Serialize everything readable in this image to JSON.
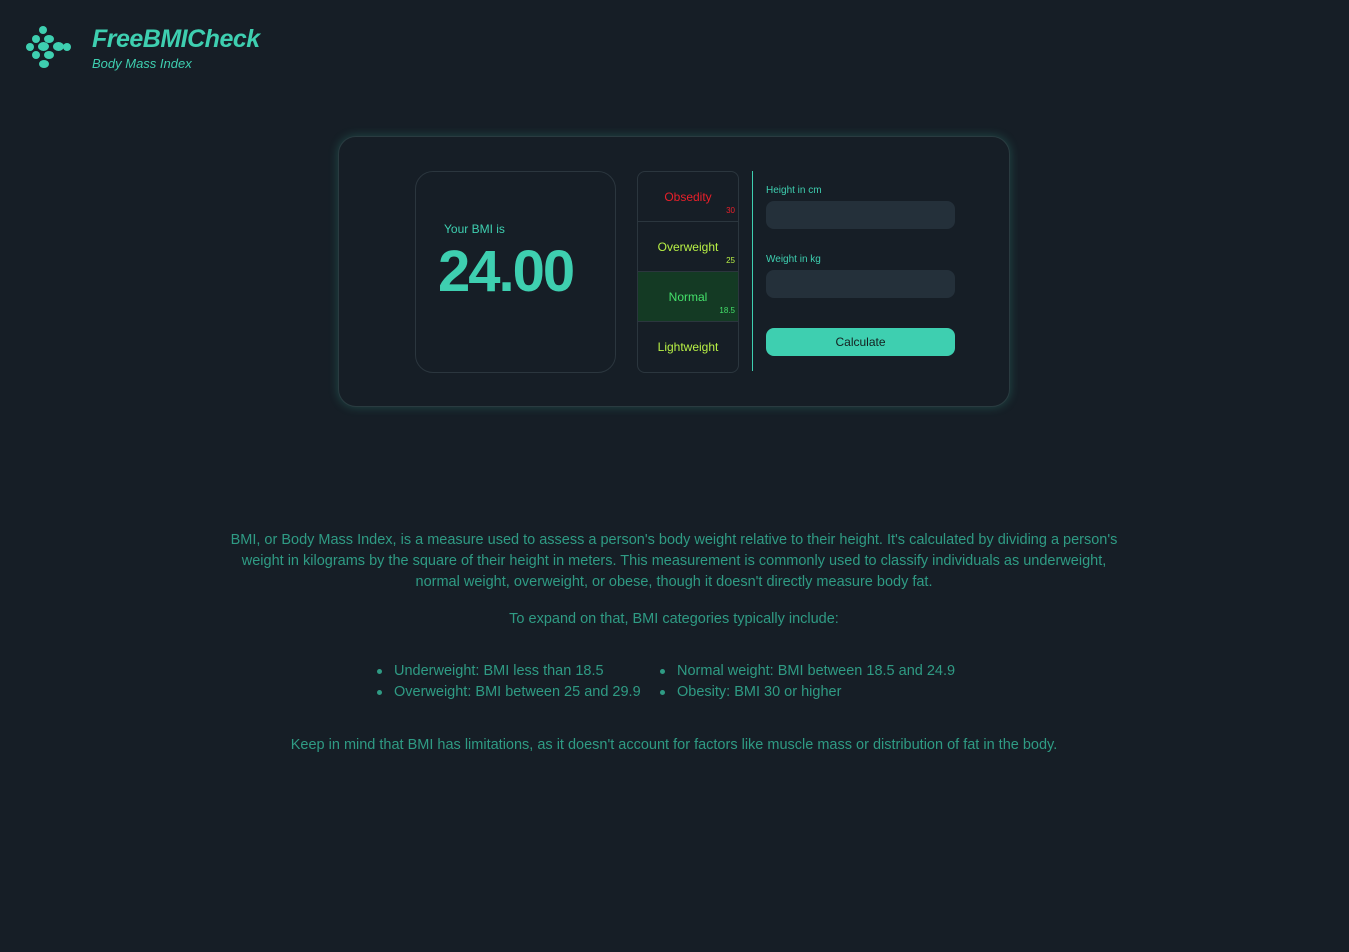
{
  "brand": {
    "name": "FreeBMICheck",
    "subtitle": "Body Mass Index",
    "logo_icon": "dots-logo-icon",
    "accent_color": "#3ecfb0"
  },
  "result": {
    "label": "Your BMI is",
    "value": "24.00"
  },
  "scale": {
    "rows": [
      {
        "label": "Obsedity",
        "threshold": "30",
        "color": "#e8202a"
      },
      {
        "label": "Overweight",
        "threshold": "25",
        "color": "#b8f045"
      },
      {
        "label": "Normal",
        "threshold": "18.5",
        "color": "#44e06a",
        "active": true
      },
      {
        "label": "Lightweight",
        "threshold": "",
        "color": "#b8f045"
      }
    ]
  },
  "form": {
    "height_label": "Height in cm",
    "height_value": "",
    "weight_label": "Weight in kg",
    "weight_value": "",
    "calculate_label": "Calculate"
  },
  "info": {
    "intro": "BMI, or Body Mass Index, is a measure used to assess a person's body weight relative to their height. It's calculated by dividing a person's weight in kilograms by the square of their height in meters. This measurement is commonly used to classify individuals as underweight, normal weight, overweight, or obese, though it doesn't directly measure body fat.",
    "expand": "To expand on that, BMI categories typically include:",
    "categories": [
      "Underweight: BMI less than 18.5",
      "Normal weight: BMI between 18.5 and 24.9",
      "Overweight: BMI between 25 and 29.9",
      "Obesity: BMI 30 or higher"
    ],
    "note": "Keep in mind that BMI has limitations, as it doesn't account for factors like muscle mass or distribution of fat in the body."
  }
}
